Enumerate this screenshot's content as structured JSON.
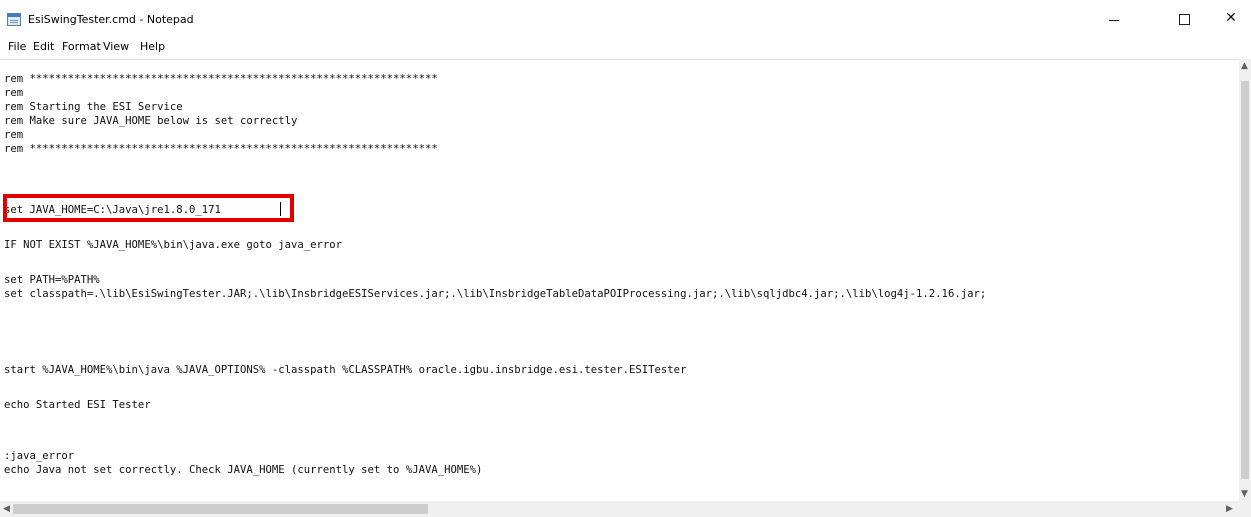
{
  "window": {
    "title": "EsiSwingTester.cmd - Notepad",
    "controls": {
      "minimize": "minimize-icon",
      "maximize": "maximize-icon",
      "close": "✕"
    }
  },
  "menu": [
    {
      "label": "File"
    },
    {
      "label": "Edit"
    },
    {
      "label": "Format"
    },
    {
      "label": "View"
    },
    {
      "label": "Help"
    }
  ],
  "editor": {
    "lines": [
      "rem ****************************************************************",
      "rem",
      "rem Starting the ESI Service",
      "rem Make sure JAVA_HOME below is set correctly",
      "rem",
      "rem ****************************************************************",
      "set JAVA_HOME=C:\\Java\\jre1.8.0_171",
      "IF NOT EXIST %JAVA_HOME%\\bin\\java.exe goto java_error",
      "set PATH=%PATH%",
      "set classpath=.\\lib\\EsiSwingTester.JAR;.\\lib\\InsbridgeESIServices.jar;.\\lib\\InsbridgeTableDataPOIProcessing.jar;.\\lib\\sqljdbc4.jar;.\\lib\\log4j-1.2.16.jar;",
      "start %JAVA_HOME%\\bin\\java %JAVA_OPTIONS% -classpath %CLASSPATH% oracle.igbu.insbridge.esi.tester.ESITester",
      "echo Started ESI Tester",
      ":java_error",
      "echo Java not set correctly. Check JAVA_HOME (currently set to %JAVA_HOME%)"
    ]
  },
  "colors": {
    "highlight_border": "#e00000"
  }
}
